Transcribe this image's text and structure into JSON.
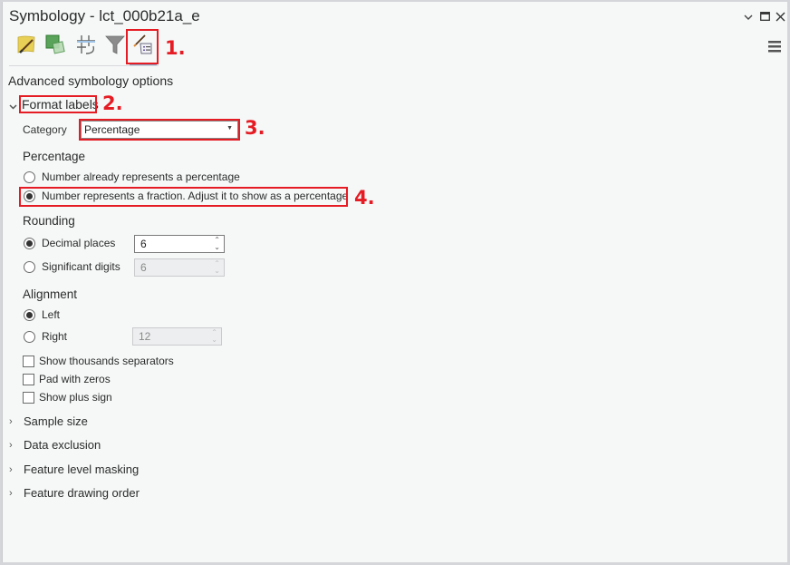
{
  "window": {
    "title": "Symbology - lct_000b21a_e",
    "controls": {
      "dropdown_icon": "chevron-down-icon",
      "maximize_icon": "maximize-icon",
      "close_icon": "close-icon"
    },
    "menu_icon": "hamburger-menu-icon"
  },
  "toolbar": {
    "items": [
      {
        "name": "primary-symbology",
        "icon": "paintbrush-polygon-icon"
      },
      {
        "name": "vary-symbology",
        "icon": "overlapping-squares-icon"
      },
      {
        "name": "symbol-layer-drawing",
        "icon": "grid-hash-icon"
      },
      {
        "name": "filter",
        "icon": "funnel-icon"
      },
      {
        "name": "advanced-symbology-options",
        "icon": "brush-list-icon",
        "active": true
      }
    ]
  },
  "callouts": [
    "1.",
    "2.",
    "3.",
    "4."
  ],
  "content": {
    "heading": "Advanced symbology options",
    "format_labels": {
      "title": "Format labels",
      "expanded": true,
      "category_label": "Category",
      "category_value": "Percentage",
      "percentage": {
        "heading": "Percentage",
        "options": [
          {
            "label": "Number already represents a percentage",
            "selected": false
          },
          {
            "label": "Number represents a fraction. Adjust it to show as a percentage",
            "selected": true
          }
        ]
      },
      "rounding": {
        "heading": "Rounding",
        "options": [
          {
            "label": "Decimal places",
            "selected": true,
            "value": "6",
            "enabled": true
          },
          {
            "label": "Significant digits",
            "selected": false,
            "value": "6",
            "enabled": false
          }
        ]
      },
      "alignment": {
        "heading": "Alignment",
        "options": [
          {
            "label": "Left",
            "selected": true
          },
          {
            "label": "Right",
            "selected": false,
            "value": "12",
            "enabled": false
          }
        ]
      },
      "checkboxes": [
        {
          "label": "Show thousands separators",
          "checked": false
        },
        {
          "label": "Pad with zeros",
          "checked": false
        },
        {
          "label": "Show plus sign",
          "checked": false
        }
      ]
    },
    "collapsed_sections": [
      {
        "label": "Sample size"
      },
      {
        "label": "Data exclusion"
      },
      {
        "label": "Feature level masking"
      },
      {
        "label": "Feature drawing order"
      }
    ]
  },
  "colors": {
    "callout_red": "#e51c23",
    "background": "#f6f8f8"
  }
}
